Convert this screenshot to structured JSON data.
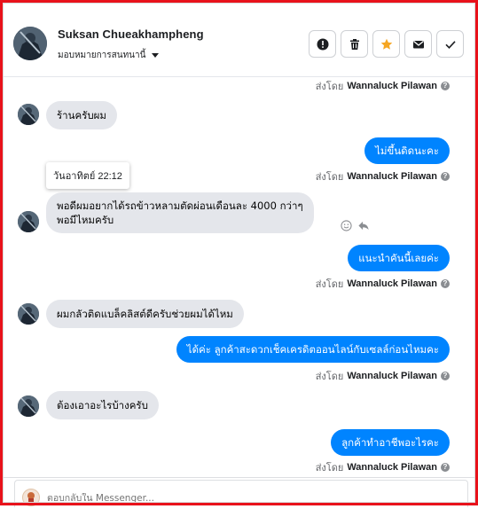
{
  "header": {
    "name": "Suksan Chueakhampheng",
    "assign_label": "มอบหมายการสนทนานี้",
    "buttons": [
      "alert-icon",
      "trash-icon",
      "star-icon",
      "mail-icon",
      "check-icon"
    ]
  },
  "sender_prefix": "ส่งโดย",
  "messages": [
    {
      "type": "sent_meta",
      "sender": "Wannaluck Pilawan"
    },
    {
      "type": "in",
      "text": "ร้านครับผม"
    },
    {
      "type": "out",
      "text": "ไม่ขึ้นดิดนะคะ",
      "sender": "Wannaluck Pilawan"
    },
    {
      "type": "tooltip",
      "text": "วันอาทิตย์ 22:12"
    },
    {
      "type": "in",
      "line1": "พอดีผมอยากได้รถข้าวหลามตัดผ่อนเดือนละ 4000 กว่าๆ",
      "line2": "พอมีไหมครับ"
    },
    {
      "type": "out",
      "text": "แนะนำคันนี้เลยค่ะ",
      "sender": "Wannaluck Pilawan"
    },
    {
      "type": "in",
      "text": "ผมกลัวติดแบล็คลิสต์ดีครับช่วยผมได้ไหม"
    },
    {
      "type": "out",
      "text": "ได้ค่ะ ลูกค้าสะดวกเช็คเครดิตออนไลน์กับเซลล์ก่อนไหมคะ",
      "sender": "Wannaluck Pilawan"
    },
    {
      "type": "in",
      "text": "ต้องเอาอะไรบ้างครับ"
    },
    {
      "type": "out",
      "text": "ลูกค้าทำอาชีพอะไรคะ",
      "sender": "Wannaluck Pilawan"
    }
  ],
  "composer": {
    "placeholder": "ตอบกลับใน Messenger..."
  },
  "colors": {
    "accent": "#0084ff",
    "frame": "#e8121b",
    "star": "#f5a623"
  }
}
